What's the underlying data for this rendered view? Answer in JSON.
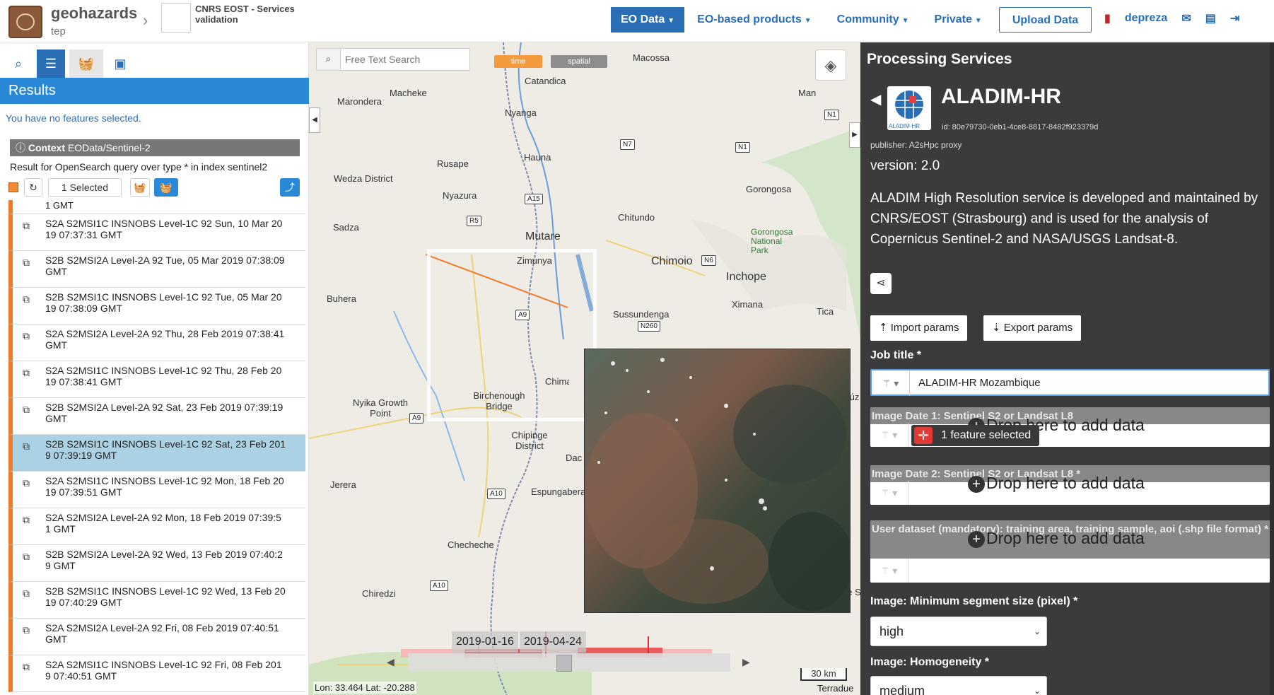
{
  "header": {
    "brand": "geohazards",
    "brand_sub": "tep",
    "project": "CNRS EOST - Services validation",
    "nav": [
      {
        "label": "EO Data",
        "active": true
      },
      {
        "label": "EO-based products",
        "active": false
      },
      {
        "label": "Community",
        "active": false
      },
      {
        "label": "Private",
        "active": false
      }
    ],
    "upload_label": "Upload Data",
    "user": "depreza"
  },
  "left_panel": {
    "results_title": "Results",
    "no_selection": "You have no features selected.",
    "context_label": "Context",
    "context_value": "EOData/Sentinel-2",
    "query_text": "Result for OpenSearch query over type * in index sentinel2",
    "selected_label": "1 Selected",
    "partial_top": "1 GMT",
    "results": [
      {
        "text": "S2A S2MSI1C INSNOBS Level-1C 92 Sun, 10 Mar 2019 07:37:31 GMT",
        "line1": "S2A S2MSI1C INSNOBS Level-1C 92 Sun, 10 Mar 20",
        "line2": "19 07:37:31 GMT",
        "selected": false
      },
      {
        "line1": "S2B S2MSI2A Level-2A 92 Tue, 05 Mar 2019 07:38:09",
        "line2": "GMT",
        "selected": false
      },
      {
        "line1": "S2B S2MSI1C INSNOBS Level-1C 92 Tue, 05 Mar 20",
        "line2": "19 07:38:09 GMT",
        "selected": false
      },
      {
        "line1": "S2A S2MSI2A Level-2A 92 Thu, 28 Feb 2019 07:38:41",
        "line2": "GMT",
        "selected": false
      },
      {
        "line1": "S2A S2MSI1C INSNOBS Level-1C 92 Thu, 28 Feb 20",
        "line2": "19 07:38:41 GMT",
        "selected": false
      },
      {
        "line1": "S2B S2MSI2A Level-2A 92 Sat, 23 Feb 2019 07:39:19",
        "line2": "GMT",
        "selected": false
      },
      {
        "line1": "S2B S2MSI1C INSNOBS Level-1C 92 Sat, 23 Feb 201",
        "line2": "9 07:39:19 GMT",
        "selected": true
      },
      {
        "line1": "S2A S2MSI1C INSNOBS Level-1C 92 Mon, 18 Feb 20",
        "line2": "19 07:39:51 GMT",
        "selected": false
      },
      {
        "line1": "S2A S2MSI2A Level-2A 92 Mon, 18 Feb 2019 07:39:5",
        "line2": "1 GMT",
        "selected": false
      },
      {
        "line1": "S2B S2MSI2A Level-2A 92 Wed, 13 Feb 2019 07:40:2",
        "line2": "9 GMT",
        "selected": false
      },
      {
        "line1": "S2B S2MSI1C INSNOBS Level-1C 92 Wed, 13 Feb 20",
        "line2": "19 07:40:29 GMT",
        "selected": false
      },
      {
        "line1": "S2A S2MSI2A Level-2A 92 Fri, 08 Feb 2019 07:40:51",
        "line2": "GMT",
        "selected": false
      },
      {
        "line1": "S2A S2MSI1C INSNOBS Level-1C 92 Fri, 08 Feb 201",
        "line2": "9 07:40:51 GMT",
        "selected": false
      }
    ]
  },
  "map": {
    "search_placeholder": "Free Text Search",
    "time_pill": "time",
    "spatial_pill": "spatial",
    "places": [
      "Macossa",
      "Catandica",
      "Marondera",
      "Macheke",
      "Nyanga",
      "Hauna",
      "Rusape",
      "Wedza District",
      "Nyazura",
      "Sadza",
      "Mutare",
      "Chitundo",
      "Gorongosa",
      "Gorongosa National Park",
      "Zimunya",
      "Chimoio",
      "Inchope",
      "Buhera",
      "Sussundenga",
      "Ximana",
      "Tica",
      "Chimanimani",
      "Birchenough Bridge",
      "Nyika Growth Point",
      "Chipinge District",
      "Jerera",
      "Espungabera",
      "Checheche",
      "Chiredzi",
      "Man",
      "Dac",
      "de Sa",
      "Búz"
    ],
    "roads": [
      "N1",
      "N7",
      "N1",
      "A15",
      "R5",
      "N6",
      "A9",
      "N260",
      "A9",
      "A10",
      "A10"
    ],
    "timeline_start": "2019-01-16",
    "timeline_end": "2019-04-24",
    "coords": "Lon: 33.464 Lat: -20.288",
    "scale": "30 km",
    "attribution": "Terradue"
  },
  "right_panel": {
    "title": "Processing Services",
    "service_name": "ALADIM-HR",
    "logo_text": "ALADIM-HR",
    "service_id": "id: 80e79730-0eb1-4ce8-8817-8482f923379d",
    "publisher": "publisher: A2sHpc proxy",
    "version": "version: 2.0",
    "description": "ALADIM High Resolution service is developed and maintained by CNRS/EOST (Strasbourg) and is used for the analysis of Copernicus Sentinel-2 and NASA/USGS Landsat-8.",
    "import_label": "Import params",
    "export_label": "Export params",
    "job_title_label": "Job title *",
    "job_title_value": "ALADIM-HR Mozambique",
    "image1_label": "Image Date 1: Sentinel S2 or Landsat L8",
    "image2_label": "Image Date 2: Sentinel S2 or Landsat L8 *",
    "user_dataset_label": "User dataset (mandatory): training area, training sample, aoi (.shp file format) *",
    "drop_text": "Drop here to add data",
    "feature_badge": "1 feature selected",
    "min_segment_label": "Image: Minimum segment size (pixel) *",
    "min_segment_value": "high",
    "homogeneity_label": "Image: Homogeneity *",
    "homogeneity_value": "medium"
  },
  "colors": {
    "accent": "#2a6fb6",
    "results_bar": "#2a88d8",
    "item_border": "#f07a28",
    "selected_row": "#abd1e4",
    "panel_bg": "#3b3b3b"
  }
}
